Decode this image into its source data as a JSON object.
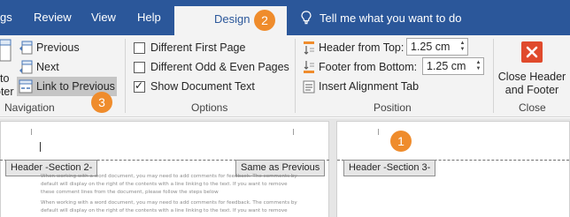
{
  "tabs": [
    {
      "label": "gs",
      "active": false
    },
    {
      "label": "Review",
      "active": false
    },
    {
      "label": "View",
      "active": false
    },
    {
      "label": "Help",
      "active": false
    },
    {
      "label": "Design",
      "active": true
    }
  ],
  "tell_me": {
    "label": "Tell me what you want to do",
    "icon": "lightbulb-icon"
  },
  "groups": {
    "navigation": {
      "label": "Navigation",
      "partial_button_lines": [
        "to",
        "oter"
      ],
      "previous": "Previous",
      "next": "Next",
      "link_to_previous": "Link to Previous",
      "link_to_previous_highlighted": true
    },
    "options": {
      "label": "Options",
      "checkboxes": [
        {
          "label": "Different First Page",
          "checked": false
        },
        {
          "label": "Different Odd & Even Pages",
          "checked": false
        },
        {
          "label": "Show Document Text",
          "checked": true
        }
      ],
      "check_mark": "✓"
    },
    "position": {
      "label": "Position",
      "header_from_top": {
        "label": "Header from Top:",
        "value": "1.25 cm"
      },
      "footer_from_bottom": {
        "label": "Footer from Bottom:",
        "value": "1.25 cm"
      },
      "insert_alignment_tab": "Insert Alignment Tab"
    },
    "close": {
      "label": "Close",
      "button_lines": [
        "Close Header",
        "and Footer"
      ],
      "icon_color": "#e04a2c"
    }
  },
  "callouts": [
    "2",
    "3",
    "1"
  ],
  "callout_color": "#ef8c2c",
  "document": {
    "header_tag_left": "Header -Section 2-",
    "same_as_previous": "Same as Previous",
    "header_tag_right": "Header -Section 3-",
    "body_lines": [
      "When working with a word document, you may need to add comments for feedback. The comments by",
      "default will display on the right of the contents with a line linking to the text. If you want to remove",
      "these comment lines from the document, please follow the steps below",
      "When working with a word document, you may need to add comments for feedback. The comments by",
      "default will display on the right of the contents with a line linking to the text. If you want to remove"
    ]
  },
  "colors": {
    "ribbon_blue": "#2b579a",
    "ribbon_bg": "#f3f3f3",
    "highlight": "#c5c5c5"
  }
}
